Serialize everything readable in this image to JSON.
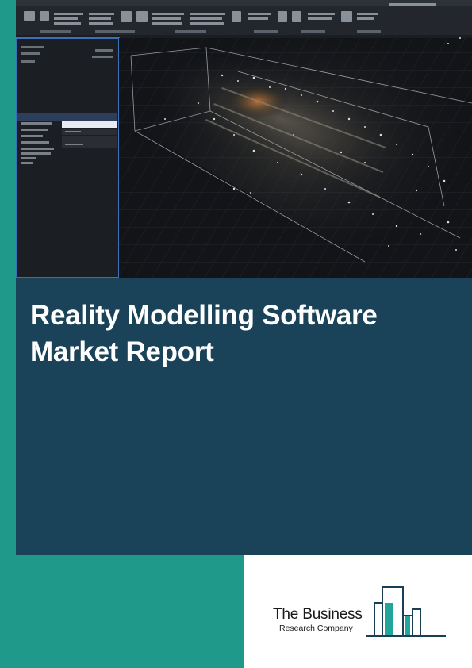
{
  "report": {
    "title_line1": "Reality Modelling Software",
    "title_line2": "Market Report"
  },
  "publisher": {
    "logo_line1": "The Business",
    "logo_line2": "Research Company"
  },
  "colors": {
    "teal": "#1f9a8a",
    "navy": "#1a4359",
    "logo_teal": "#22a59a",
    "logo_dark": "#1a3f55"
  },
  "icons": [
    "point-cloud-screenshot",
    "business-research-logo"
  ]
}
